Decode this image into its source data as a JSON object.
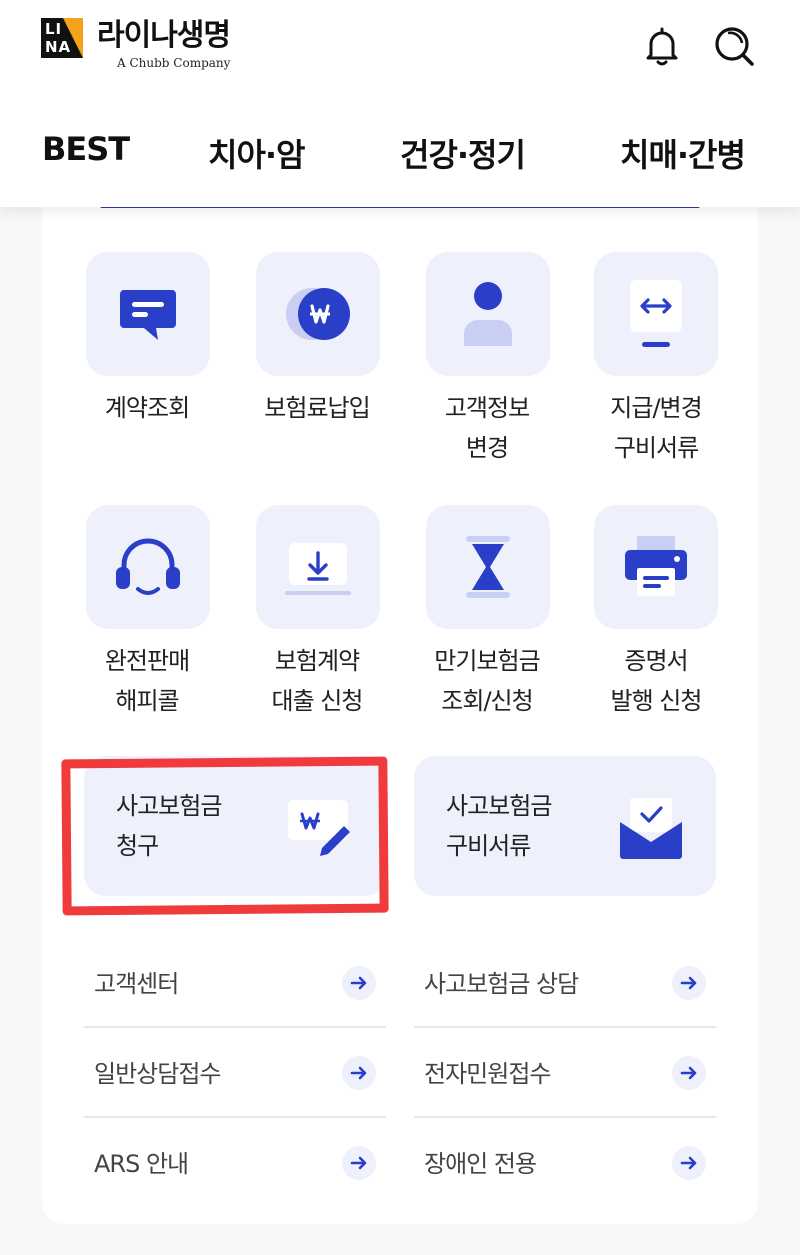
{
  "header": {
    "logo_mark_line1": "LI",
    "logo_mark_line2": "NA",
    "brand_name": "라이나생명",
    "brand_sub": "A Chubb Company",
    "icons": [
      "bell-icon",
      "search-icon"
    ]
  },
  "tabs": [
    "BEST",
    "치아·암",
    "건강·정기",
    "치매·간병"
  ],
  "menu": [
    {
      "lines": [
        "계약조회"
      ],
      "icon": "chat-bubble-icon"
    },
    {
      "lines": [
        "보험료납입"
      ],
      "icon": "won-coin-icon"
    },
    {
      "lines": [
        "고객정보",
        "변경"
      ],
      "icon": "person-icon"
    },
    {
      "lines": [
        "지급/변경",
        "구비서류"
      ],
      "icon": "exchange-doc-icon"
    },
    {
      "lines": [
        "완전판매",
        "해피콜"
      ],
      "icon": "headset-icon"
    },
    {
      "lines": [
        "보험계약",
        "대출 신청"
      ],
      "icon": "download-card-icon"
    },
    {
      "lines": [
        "만기보험금",
        "조회/신청"
      ],
      "icon": "hourglass-icon"
    },
    {
      "lines": [
        "증명서",
        "발행 신청"
      ],
      "icon": "printer-icon"
    }
  ],
  "claims": [
    {
      "lines": [
        "사고보험금",
        "청구"
      ],
      "icon": "won-pen-icon"
    },
    {
      "lines": [
        "사고보험금",
        "구비서류"
      ],
      "icon": "envelope-check-icon"
    }
  ],
  "links": [
    {
      "label": "고객센터"
    },
    {
      "label": "사고보험금 상담"
    },
    {
      "label": "일반상담접수"
    },
    {
      "label": "전자민원접수"
    },
    {
      "label": "ARS 안내"
    },
    {
      "label": "장애인 전용"
    }
  ],
  "colors": {
    "accent": "#2a3fc8",
    "tile_bg": "#eef0fb",
    "highlight": "#ef3b3b",
    "logo_orange": "#f3a21a"
  }
}
